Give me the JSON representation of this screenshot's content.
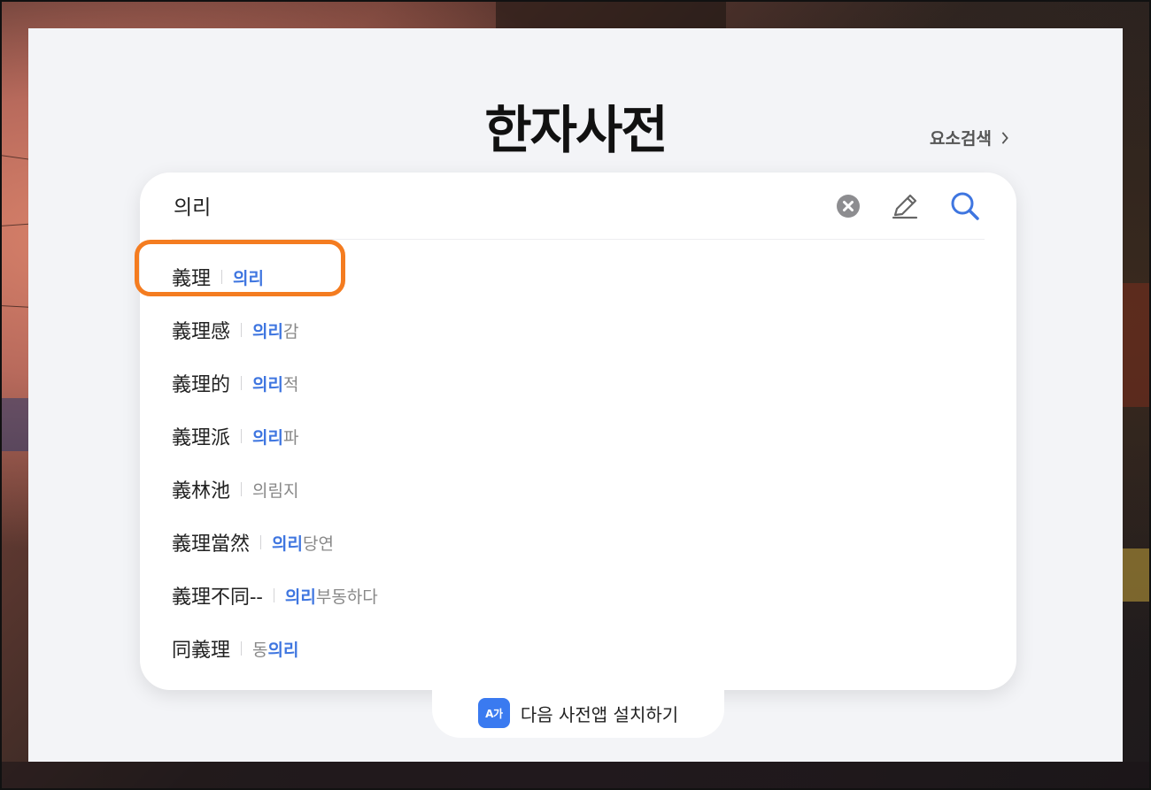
{
  "page": {
    "title": "한자사전",
    "element_search_label": "요소검색"
  },
  "search": {
    "query": "의리",
    "clear_icon": "clear-circle-icon",
    "handwrite_icon": "pencil-icon",
    "search_icon": "magnifier-icon"
  },
  "suggestions": [
    {
      "hanja": "義理",
      "match": "의리",
      "rest_before": "",
      "rest_after": ""
    },
    {
      "hanja": "義理感",
      "match": "의리",
      "rest_before": "",
      "rest_after": "감"
    },
    {
      "hanja": "義理的",
      "match": "의리",
      "rest_before": "",
      "rest_after": "적"
    },
    {
      "hanja": "義理派",
      "match": "의리",
      "rest_before": "",
      "rest_after": "파"
    },
    {
      "hanja": "義林池",
      "match": "",
      "rest_before": "의림지",
      "rest_after": ""
    },
    {
      "hanja": "義理當然",
      "match": "의리",
      "rest_before": "",
      "rest_after": "당연"
    },
    {
      "hanja": "義理不同--",
      "match": "의리",
      "rest_before": "",
      "rest_after": "부동하다"
    },
    {
      "hanja": "同義理",
      "match": "의리",
      "rest_before": "동",
      "rest_after": ""
    }
  ],
  "install": {
    "app_icon_text": "A가",
    "label": "다음 사전앱 설치하기"
  },
  "colors": {
    "accent_blue": "#3f76e0",
    "highlight_orange": "#f47c20",
    "panel_bg": "#f3f4f7"
  }
}
